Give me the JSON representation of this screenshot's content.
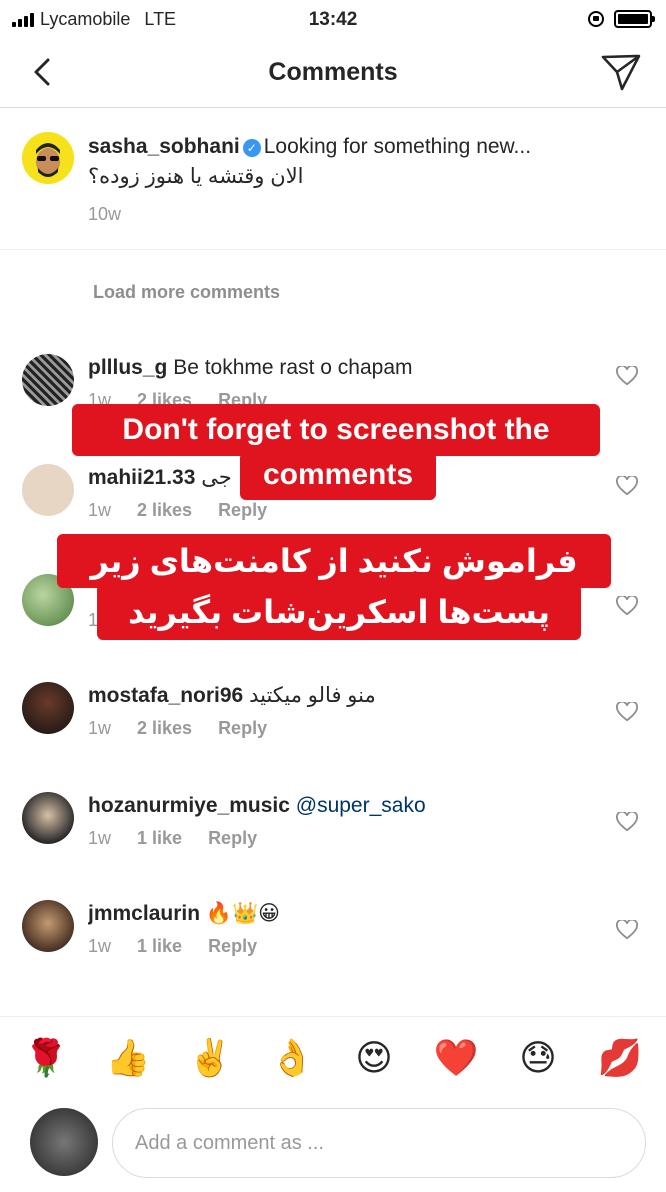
{
  "status_bar": {
    "carrier": "Lycamobile",
    "network": "LTE",
    "time": "13:42"
  },
  "nav": {
    "title": "Comments"
  },
  "caption": {
    "username": "sasha_sobhani",
    "text": "Looking for something new...",
    "text_persian": "الان وقتشه یا هنوز زوده؟",
    "time_ago": "10w"
  },
  "load_more": "Load more comments",
  "comments": [
    {
      "username": "plllus_g",
      "text": "Be tokhme rast o chapam",
      "time_ago": "1w",
      "likes": "2 likes",
      "reply": "Reply"
    },
    {
      "username": "mahii21.33",
      "text": "جی",
      "time_ago": "1w",
      "likes": "2 likes",
      "reply": "Reply"
    },
    {
      "username": "",
      "text": "",
      "time_ago": "1",
      "likes": "",
      "reply": ""
    },
    {
      "username": "mostafa_nori96",
      "text": "منو فالو میکتید",
      "time_ago": "1w",
      "likes": "2 likes",
      "reply": "Reply"
    },
    {
      "username": "hozanurmiye_music",
      "text": "@super_sako",
      "time_ago": "1w",
      "likes": "1 like",
      "reply": "Reply"
    },
    {
      "username": "jmmclaurin",
      "text": "🔥👑😀",
      "time_ago": "1w",
      "likes": "1 like",
      "reply": "Reply"
    }
  ],
  "banners": {
    "line1": "Don't forget to screenshot the",
    "line2": "comments",
    "line3": "فراموش نکنید از کامنت‌های زیر",
    "line4": "پست‌ها اسکرین‌شات بگیرید"
  },
  "emoji_bar": [
    "🌹",
    "👍",
    "✌️",
    "👌",
    "😍",
    "❤️",
    "😓",
    "💋"
  ],
  "input": {
    "placeholder": "Add a comment as ..."
  },
  "colors": {
    "banner_red": "#e0141e",
    "verified_blue": "#3897f0",
    "muted_text": "#999999"
  }
}
